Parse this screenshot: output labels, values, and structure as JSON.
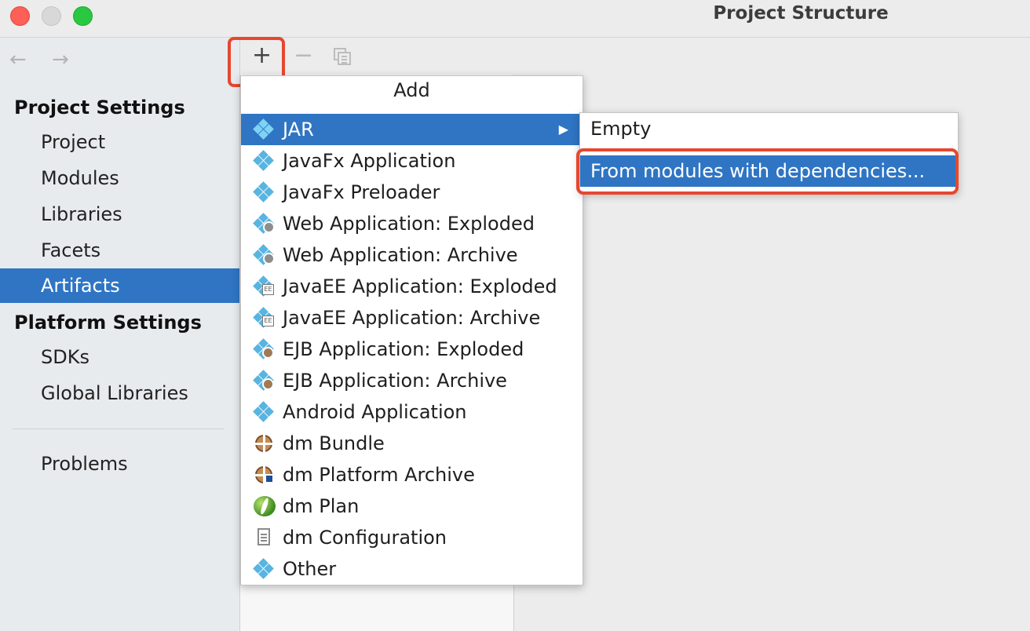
{
  "window": {
    "title": "Project Structure"
  },
  "navigation": {
    "back_icon": "←",
    "forward_icon": "→"
  },
  "sidebar": {
    "project_settings_heading": "Project Settings",
    "project_items": [
      "Project",
      "Modules",
      "Libraries",
      "Facets",
      "Artifacts"
    ],
    "selected_item": "Artifacts",
    "platform_settings_heading": "Platform Settings",
    "platform_items": [
      "SDKs",
      "Global Libraries"
    ],
    "problems": "Problems"
  },
  "toolbar": {
    "add_icon": "+",
    "remove_icon": "−",
    "copy_icon": "copy-icon"
  },
  "add_popup": {
    "title": "Add",
    "items": [
      {
        "label": "JAR",
        "icon": "artifact-icon",
        "selected": true,
        "has_submenu": true
      },
      {
        "label": "JavaFx Application",
        "icon": "artifact-icon"
      },
      {
        "label": "JavaFx Preloader",
        "icon": "artifact-icon"
      },
      {
        "label": "Web Application: Exploded",
        "icon": "web-artifact-icon"
      },
      {
        "label": "Web Application: Archive",
        "icon": "web-artifact-icon"
      },
      {
        "label": "JavaEE Application: Exploded",
        "icon": "javaee-artifact-icon"
      },
      {
        "label": "JavaEE Application: Archive",
        "icon": "javaee-artifact-icon"
      },
      {
        "label": "EJB Application: Exploded",
        "icon": "ejb-artifact-icon"
      },
      {
        "label": "EJB Application: Archive",
        "icon": "ejb-artifact-icon"
      },
      {
        "label": "Android Application",
        "icon": "artifact-icon"
      },
      {
        "label": "dm Bundle",
        "icon": "bundle-icon"
      },
      {
        "label": "dm Platform Archive",
        "icon": "platform-archive-icon"
      },
      {
        "label": "dm Plan",
        "icon": "plan-icon"
      },
      {
        "label": "dm Configuration",
        "icon": "configuration-icon"
      },
      {
        "label": "Other",
        "icon": "artifact-icon"
      }
    ],
    "submenu_arrow": "▶"
  },
  "jar_submenu": {
    "items": [
      {
        "label": "Empty",
        "selected": false
      },
      {
        "label": "From modules with dependencies...",
        "selected": true
      }
    ]
  },
  "colors": {
    "selection": "#2f75c4",
    "highlight_box": "#e6472f"
  }
}
